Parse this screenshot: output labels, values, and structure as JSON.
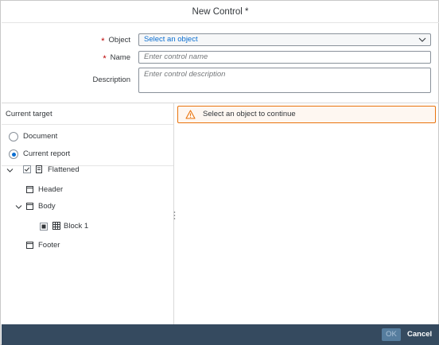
{
  "dialog": {
    "title": "New Control *",
    "form": {
      "object": {
        "label": "Object",
        "required_mark": "*",
        "value": "Select an object"
      },
      "name": {
        "label": "Name",
        "required_mark": "*",
        "placeholder": "Enter control name"
      },
      "description": {
        "label": "Description",
        "placeholder": "Enter control description"
      }
    },
    "left_pane": {
      "header": "Current target",
      "radios": [
        {
          "label": "Document",
          "checked": false
        },
        {
          "label": "Current report",
          "checked": true
        }
      ],
      "tree": {
        "root": {
          "label": "Flattened",
          "icon": "report-icon"
        },
        "children": [
          {
            "label": "Header",
            "icon": "section-icon"
          },
          {
            "label": "Body",
            "icon": "section-icon"
          },
          {
            "label": "Block 1",
            "icon": "table-icon"
          },
          {
            "label": "Footer",
            "icon": "section-icon"
          }
        ]
      }
    },
    "right_pane": {
      "warning": "Select an object to continue"
    },
    "footer": {
      "ok_label": "OK",
      "cancel_label": "Cancel"
    }
  }
}
